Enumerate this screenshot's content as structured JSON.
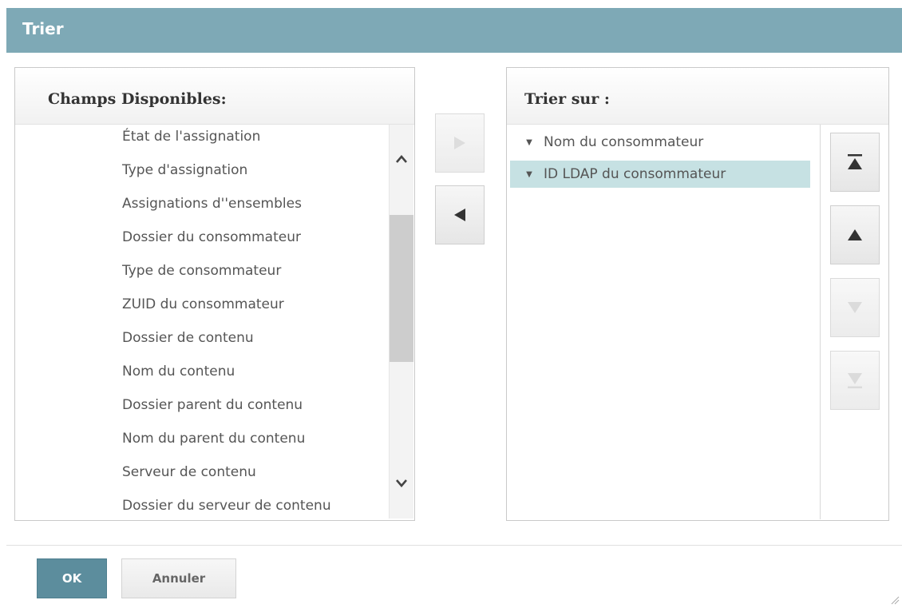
{
  "dialog": {
    "title": "Trier"
  },
  "left_panel": {
    "title": "Champs Disponibles:",
    "items": [
      "État de l'assignation",
      "Type d'assignation",
      "Assignations d''ensembles",
      "Dossier du consommateur",
      "Type de consommateur",
      "ZUID du consommateur",
      "Dossier de contenu",
      "Nom du contenu",
      "Dossier parent du contenu",
      "Nom du parent du contenu",
      "Serveur de contenu",
      "Dossier du serveur de contenu"
    ]
  },
  "right_panel": {
    "title": "Trier sur :",
    "items": [
      {
        "label": "Nom du consommateur",
        "selected": false
      },
      {
        "label": "ID LDAP du consommateur",
        "selected": true
      }
    ]
  },
  "footer": {
    "ok_label": "OK",
    "cancel_label": "Annuler"
  },
  "colors": {
    "titlebar": "#7ea9b6",
    "ok_button": "#5c8d9d",
    "selection": "#c6e1e3"
  }
}
